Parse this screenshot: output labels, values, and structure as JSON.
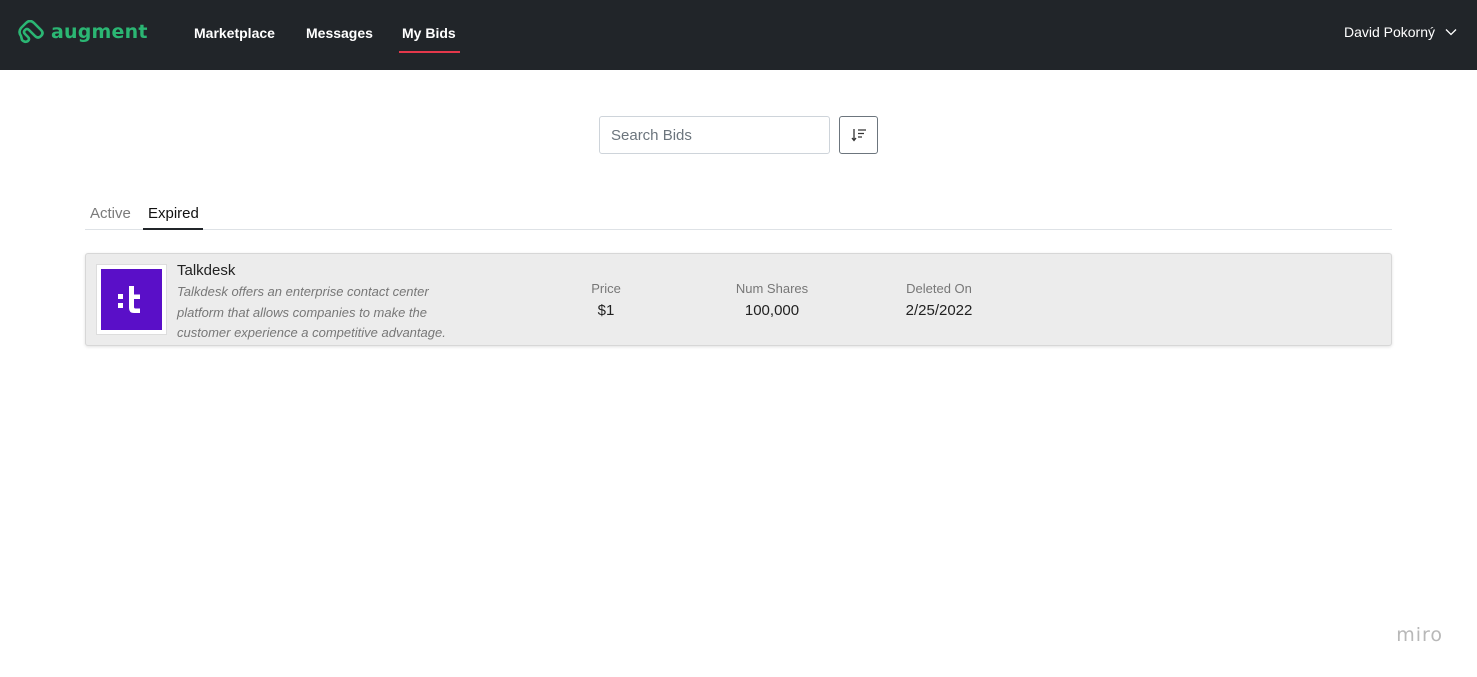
{
  "brand": {
    "name": "augment",
    "color": "#2bb673"
  },
  "nav": {
    "items": [
      {
        "label": "Marketplace",
        "active": false
      },
      {
        "label": "Messages",
        "active": false
      },
      {
        "label": "My Bids",
        "active": true
      }
    ],
    "user_name": "David Pokorný",
    "user_menu_icon": "chevron-down-icon"
  },
  "search": {
    "placeholder": "Search Bids",
    "value": "",
    "sort_icon": "sort-descending-icon"
  },
  "tabs": [
    {
      "label": "Active",
      "selected": false
    },
    {
      "label": "Expired",
      "selected": true
    }
  ],
  "bids": [
    {
      "company": "Talkdesk",
      "logo_text": ":t",
      "logo_color": "#5a0fc8",
      "description": "Talkdesk offers an enterprise contact center platform that allows companies to make the customer experience a competitive advantage.",
      "price_label": "Price",
      "price": "$1",
      "shares_label": "Num Shares",
      "shares": "100,000",
      "deleted_label": "Deleted On",
      "deleted_on": "2/25/2022"
    }
  ],
  "watermark": "miro",
  "colors": {
    "nav_bg": "#212529",
    "active_underline": "#e4384b"
  }
}
